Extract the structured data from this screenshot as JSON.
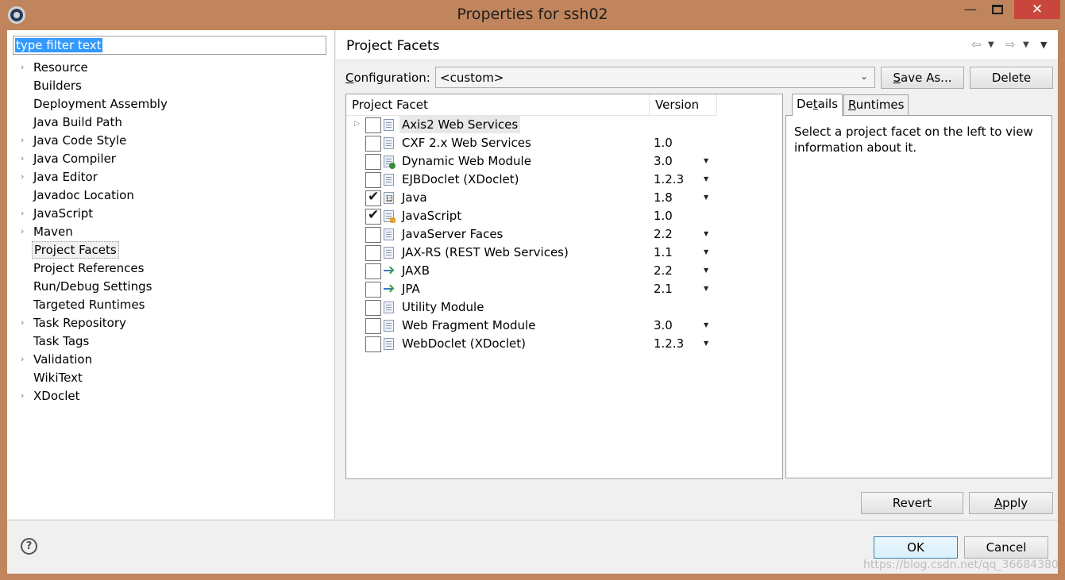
{
  "window": {
    "title": "Properties for ssh02",
    "minimize": "—",
    "close": "✕"
  },
  "filter": {
    "value": "type filter text"
  },
  "nav": [
    {
      "label": "Resource",
      "expandable": true
    },
    {
      "label": "Builders",
      "expandable": false
    },
    {
      "label": "Deployment Assembly",
      "expandable": false
    },
    {
      "label": "Java Build Path",
      "expandable": false
    },
    {
      "label": "Java Code Style",
      "expandable": true
    },
    {
      "label": "Java Compiler",
      "expandable": true
    },
    {
      "label": "Java Editor",
      "expandable": true
    },
    {
      "label": "Javadoc Location",
      "expandable": false
    },
    {
      "label": "JavaScript",
      "expandable": true
    },
    {
      "label": "Maven",
      "expandable": true
    },
    {
      "label": "Project Facets",
      "expandable": false,
      "selected": true
    },
    {
      "label": "Project References",
      "expandable": false
    },
    {
      "label": "Run/Debug Settings",
      "expandable": false
    },
    {
      "label": "Targeted Runtimes",
      "expandable": false
    },
    {
      "label": "Task Repository",
      "expandable": true
    },
    {
      "label": "Task Tags",
      "expandable": false
    },
    {
      "label": "Validation",
      "expandable": true
    },
    {
      "label": "WikiText",
      "expandable": false
    },
    {
      "label": "XDoclet",
      "expandable": true
    }
  ],
  "page": {
    "title": "Project Facets"
  },
  "history": {
    "back_icon": "⇦",
    "forward_icon": "⇨",
    "dropdown_icon": "▼"
  },
  "configuration": {
    "label_accel": "C",
    "label_rest": "onfiguration:",
    "value": "<custom>",
    "dropdown_icon": "⌄"
  },
  "buttons": {
    "save_as_accel": "S",
    "save_as_rest": "ave As...",
    "delete": "Delete",
    "revert": "Revert",
    "apply_accel": "A",
    "apply_rest": "pply",
    "ok": "OK",
    "cancel": "Cancel"
  },
  "facet_table": {
    "headers": {
      "facet": "Project Facet",
      "version": "Version"
    },
    "rows": [
      {
        "name": "Axis2 Web Services",
        "version": "",
        "checked": false,
        "icon": "page-icon",
        "dropdown": false,
        "expander": true,
        "hover": true
      },
      {
        "name": "CXF 2.x Web Services",
        "version": "1.0",
        "checked": false,
        "icon": "page-icon",
        "dropdown": false
      },
      {
        "name": "Dynamic Web Module",
        "version": "3.0",
        "checked": false,
        "icon": "globe-icon",
        "dropdown": true
      },
      {
        "name": "EJBDoclet (XDoclet)",
        "version": "1.2.3",
        "checked": false,
        "icon": "page-icon",
        "dropdown": true
      },
      {
        "name": "Java",
        "version": "1.8",
        "checked": true,
        "icon": "java-icon",
        "dropdown": true
      },
      {
        "name": "JavaScript",
        "version": "1.0",
        "checked": true,
        "icon": "javascript-icon",
        "dropdown": false
      },
      {
        "name": "JavaServer Faces",
        "version": "2.2",
        "checked": false,
        "icon": "page-icon",
        "dropdown": true
      },
      {
        "name": "JAX-RS (REST Web Services)",
        "version": "1.1",
        "checked": false,
        "icon": "page-icon",
        "dropdown": true
      },
      {
        "name": "JAXB",
        "version": "2.2",
        "checked": false,
        "icon": "xml-binding-icon",
        "dropdown": true
      },
      {
        "name": "JPA",
        "version": "2.1",
        "checked": false,
        "icon": "xml-binding-icon",
        "dropdown": true
      },
      {
        "name": "Utility Module",
        "version": "",
        "checked": false,
        "icon": "page-icon",
        "dropdown": false
      },
      {
        "name": "Web Fragment Module",
        "version": "3.0",
        "checked": false,
        "icon": "page-icon",
        "dropdown": true
      },
      {
        "name": "WebDoclet (XDoclet)",
        "version": "1.2.3",
        "checked": false,
        "icon": "page-icon",
        "dropdown": true
      }
    ]
  },
  "details": {
    "tabs": [
      {
        "accel_pre": "De",
        "accel": "t",
        "rest": "ails"
      },
      {
        "accel_pre": "",
        "accel": "R",
        "rest": "untimes"
      }
    ],
    "text": "Select a project facet on the left to view information about it."
  },
  "footer": {
    "help_icon": "?",
    "watermark": "https://blog.csdn.net/qq_36684380"
  },
  "colors": {
    "window_frame": "#c0855c",
    "close_button": "#c9463d",
    "selection": "#3399ff",
    "ok_border": "#3c7fb1"
  }
}
